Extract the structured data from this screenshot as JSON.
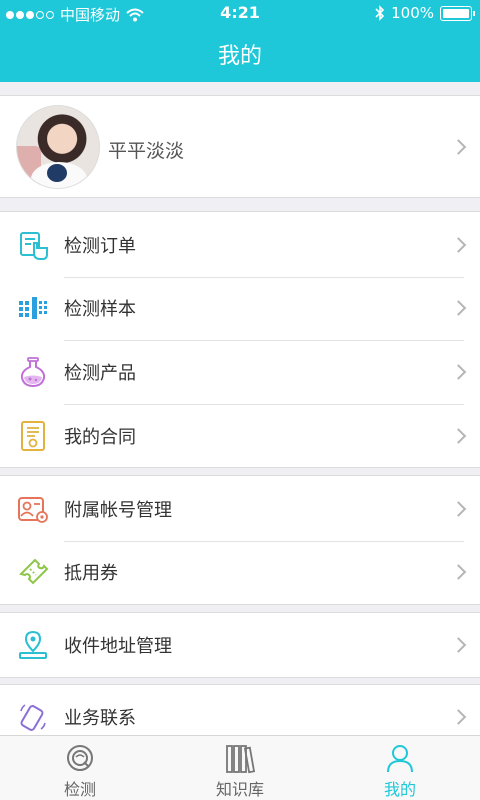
{
  "status_bar": {
    "carrier": "中国移动",
    "time": "4:21",
    "battery": "100%"
  },
  "nav": {
    "title": "我的"
  },
  "profile": {
    "name": "平平淡淡"
  },
  "menu_group_1": [
    {
      "label": "检测订单",
      "icon": "order-hand-icon"
    },
    {
      "label": "检测样本",
      "icon": "sample-icon"
    },
    {
      "label": "检测产品",
      "icon": "flask-icon"
    },
    {
      "label": "我的合同",
      "icon": "contract-icon"
    }
  ],
  "menu_group_2": [
    {
      "label": "附属帐号管理",
      "icon": "account-settings-icon"
    },
    {
      "label": "抵用券",
      "icon": "coupon-icon"
    }
  ],
  "menu_group_3": [
    {
      "label": "收件地址管理",
      "icon": "location-icon"
    }
  ],
  "menu_group_4": [
    {
      "label": "业务联系",
      "icon": "phone-icon"
    }
  ],
  "tabs": [
    {
      "label": "检测",
      "icon": "detect-icon"
    },
    {
      "label": "知识库",
      "icon": "books-icon"
    },
    {
      "label": "我的",
      "icon": "person-icon"
    }
  ],
  "colors": {
    "accent": "#1ec8d8",
    "background": "#efeff4"
  }
}
